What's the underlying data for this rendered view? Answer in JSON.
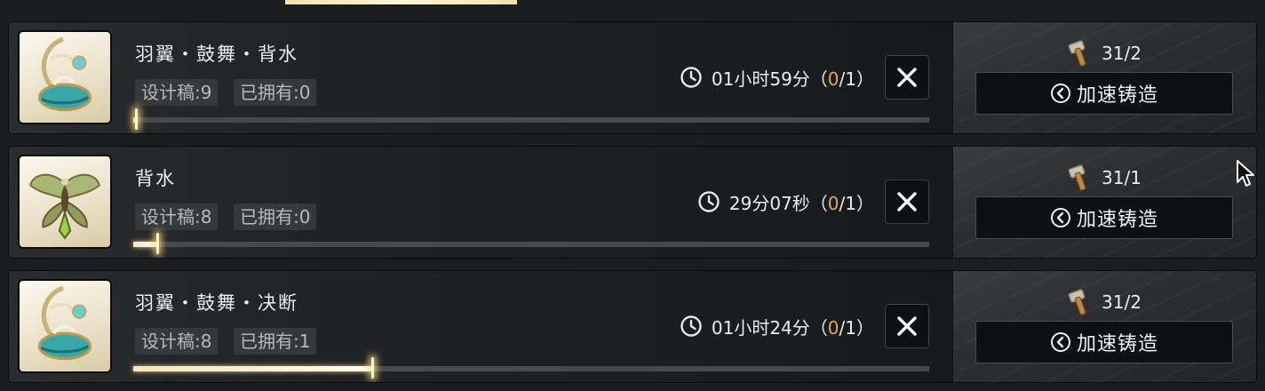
{
  "colors": {
    "accent_count": "#e3a35a",
    "progress_fill": "#f4e7c0",
    "card_bg": "#202224"
  },
  "queue": [
    {
      "name": "羽翼・鼓舞・背水",
      "drafts_label": "设计稿:9",
      "owned_label": "已拥有:0",
      "time_prefix": "01小时59分（",
      "count_current": "0",
      "count_suffix": "/1）",
      "hammer_count": "31/2",
      "speed_label": "加速铸造",
      "progress": 0.003,
      "icon": "wing-emblem-blue-icon"
    },
    {
      "name": "背水",
      "drafts_label": "设计稿:8",
      "owned_label": "已拥有:0",
      "time_prefix": "29分07秒（",
      "count_current": "0",
      "count_suffix": "/1）",
      "hammer_count": "31/1",
      "speed_label": "加速铸造",
      "progress": 0.03,
      "icon": "butterfly-emblem-green-icon"
    },
    {
      "name": "羽翼・鼓舞・决断",
      "drafts_label": "设计稿:8",
      "owned_label": "已拥有:1",
      "time_prefix": "01小时24分（",
      "count_current": "0",
      "count_suffix": "/1）",
      "hammer_count": "31/2",
      "speed_label": "加速铸造",
      "progress": 0.3,
      "icon": "wing-emblem-blue-icon"
    }
  ]
}
